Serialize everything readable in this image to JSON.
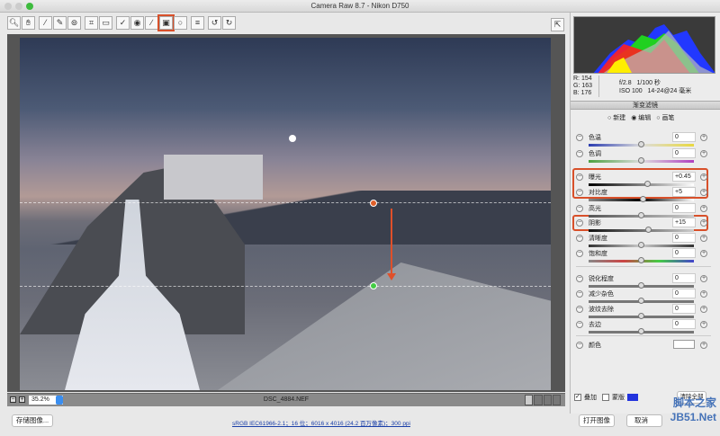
{
  "window": {
    "title": "Camera Raw 8.7 -  Nikon D750"
  },
  "toolbar": {
    "tools": [
      "zoom",
      "hand",
      "white-balance",
      "color-sampler",
      "targeted-adjustment",
      "crop",
      "straighten",
      "spot-removal",
      "red-eye",
      "adjustment-brush",
      "graduated-filter",
      "radial-filter",
      "presets",
      "rotate-left",
      "rotate-right"
    ],
    "active": "graduated-filter"
  },
  "readout": {
    "r_label": "R:",
    "r": "154",
    "g_label": "G:",
    "g": "163",
    "b_label": "B:",
    "b": "176",
    "aperture": "f/2.8",
    "shutter": "1/100 秒",
    "iso": "ISO 100",
    "lens": "14-24@24 毫米"
  },
  "panel": {
    "title": "渐变滤镜",
    "modes": [
      "新建",
      "编辑",
      "画笔"
    ],
    "selected_mode": "编辑",
    "sliders": [
      {
        "label": "色温",
        "value": "0",
        "pos": 0.5
      },
      {
        "label": "色调",
        "value": "0",
        "pos": 0.5
      },
      {
        "label": "曝光",
        "value": "+0.45",
        "pos": 0.56
      },
      {
        "label": "对比度",
        "value": "+5",
        "pos": 0.52
      },
      {
        "label": "高光",
        "value": "0",
        "pos": 0.5
      },
      {
        "label": "阴影",
        "value": "+15",
        "pos": 0.57
      },
      {
        "label": "清晰度",
        "value": "0",
        "pos": 0.5
      },
      {
        "label": "饱和度",
        "value": "0",
        "pos": 0.5
      },
      {
        "label": "锐化程度",
        "value": "0",
        "pos": 0.5
      },
      {
        "label": "减少杂色",
        "value": "0",
        "pos": 0.5
      },
      {
        "label": "波纹去除",
        "value": "0",
        "pos": 0.5
      },
      {
        "label": "去边",
        "value": "0",
        "pos": 0.5
      }
    ],
    "color_label": "颜色",
    "overlay_label": "叠加",
    "overlay_checked": true,
    "mask_label": "蒙版",
    "mask_checked": false,
    "mask_color": "#2233dd",
    "clear_all": "清除全部"
  },
  "status": {
    "zoom": "35.2%",
    "filename": "DSC_4884.NEF"
  },
  "footer": {
    "save": "存储图像...",
    "info": "sRGB IEC61966-2.1；16 位；6016 x 4016 (24.2 百万像素)；300 ppi",
    "open": "打开图像",
    "cancel": "取消",
    "watermark": "脚本之家 JB51.Net"
  },
  "colors": {
    "highlight": "#d8502a"
  }
}
